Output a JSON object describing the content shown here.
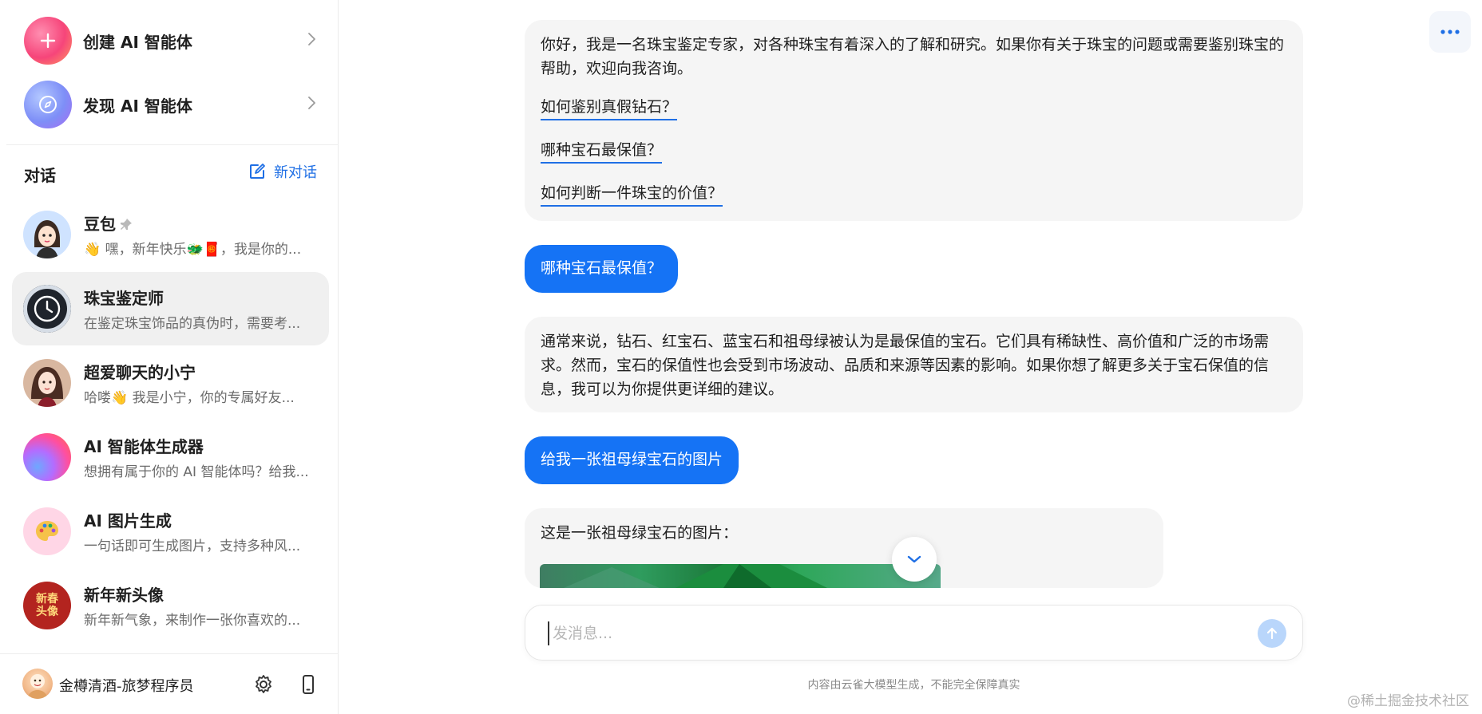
{
  "sidebar": {
    "create_agent": "创建 AI 智能体",
    "discover_agent": "发现 AI 智能体",
    "conversations_title": "对话",
    "new_chat": "新对话",
    "chats": [
      {
        "name": "豆包",
        "preview": "👋 嘿，新年快乐🐲🧧，我是你的...",
        "pinned": true
      },
      {
        "name": "珠宝鉴定师",
        "preview": "在鉴定珠宝饰品的真伪时，需要考...",
        "active": true
      },
      {
        "name": "超爱聊天的小宁",
        "preview": "哈喽👋 我是小宁，你的专属好友..."
      },
      {
        "name": "AI 智能体生成器",
        "preview": "想拥有属于你的 AI 智能体吗？给我..."
      },
      {
        "name": "AI 图片生成",
        "preview": "一句话即可生成图片，支持多种风..."
      },
      {
        "name": "新年新头像",
        "preview": "新年新气象，来制作一张你喜欢的...",
        "avatar_text": "新春\n头像"
      }
    ],
    "user_name": "金樽清酒-旅梦程序员"
  },
  "messages": {
    "m1_text": "你好，我是一名珠宝鉴定专家，对各种珠宝有着深入的了解和研究。如果你有关于珠宝的问题或需要鉴别珠宝的帮助，欢迎向我咨询。",
    "suggestions": [
      "如何鉴别真假钻石？",
      "哪种宝石最保值？",
      "如何判断一件珠宝的价值？"
    ],
    "m2_text": "哪种宝石最保值？",
    "m3_text": "通常来说，钻石、红宝石、蓝宝石和祖母绿被认为是最保值的宝石。它们具有稀缺性、高价值和广泛的市场需求。然而，宝石的保值性也会受到市场波动、品质和来源等因素的影响。如果你想了解更多关于宝石保值的信息，我可以为你提供更详细的建议。",
    "m4_text": "给我一张祖母绿宝石的图片",
    "m5_text": "这是一张祖母绿宝石的图片："
  },
  "input": {
    "placeholder": "发消息..."
  },
  "disclaimer": "内容由云雀大模型生成，不能完全保障真实",
  "watermark": "@稀土掘金技术社区",
  "colors": {
    "accent": "#1573f5",
    "link_underline": "#1f6fe5",
    "active_bg": "#f0f0f0"
  }
}
